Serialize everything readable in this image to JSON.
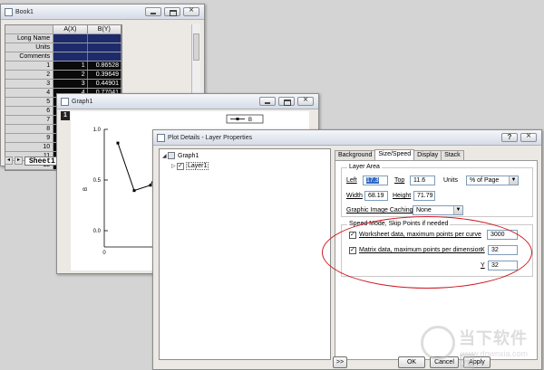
{
  "book1": {
    "title": "Book1",
    "columns": [
      "A(X)",
      "B(Y)"
    ],
    "meta_rows": [
      "Long Name",
      "Units",
      "Comments"
    ],
    "rows": [
      {
        "n": "1",
        "a": "1",
        "b": "0.86528"
      },
      {
        "n": "2",
        "a": "2",
        "b": "0.39649"
      },
      {
        "n": "3",
        "a": "3",
        "b": "0.44901"
      },
      {
        "n": "4",
        "a": "4",
        "b": "0.77041"
      },
      {
        "n": "5",
        "a": "",
        "b": ""
      },
      {
        "n": "6",
        "a": "",
        "b": ""
      },
      {
        "n": "7",
        "a": "",
        "b": ""
      },
      {
        "n": "8",
        "a": "",
        "b": ""
      },
      {
        "n": "9",
        "a": "",
        "b": ""
      },
      {
        "n": "10",
        "a": "",
        "b": ""
      },
      {
        "n": "11",
        "a": "",
        "b": ""
      },
      {
        "n": "12",
        "a": "",
        "b": ""
      }
    ],
    "sheet_tab": "Sheet1"
  },
  "graph1": {
    "title": "Graph1",
    "layer_number": "1",
    "legend": "B",
    "ylabel": "B",
    "yticks": [
      "1.0",
      "0.5",
      "0.0"
    ],
    "xtick": "0",
    "series": [
      0.865,
      0.396,
      0.449,
      0.77
    ]
  },
  "plot_details": {
    "title": "Plot Details - Layer Properties",
    "tree": {
      "root": "Graph1",
      "child": "Layer1"
    },
    "tabs": [
      "Background",
      "Size/Speed",
      "Display",
      "Stack"
    ],
    "active_tab": "Size/Speed",
    "layer_area": {
      "group": "Layer Area",
      "left_label": "Left",
      "left_value": "17.3",
      "top_label": "Top",
      "top_value": "11.6",
      "units_label": "Units",
      "units_value": "% of Page",
      "width_label": "Width",
      "width_value": "68.19",
      "height_label": "Height",
      "height_value": "71.79",
      "caching_label": "Graphic Image Caching",
      "caching_value": "None"
    },
    "speed_mode": {
      "group": "Speed Mode, Skip Points if needed",
      "worksheet_label": "Worksheet data, maximum points per curve",
      "worksheet_value": "3000",
      "matrix_label": "Matrix data, maximum points per dimension",
      "x_label": "X",
      "x_value": "32",
      "y_label": "Y",
      "y_value": "32"
    },
    "buttons": {
      "expand": ">>",
      "ok": "OK",
      "cancel": "Cancel",
      "apply": "Apply"
    }
  },
  "watermark": {
    "cn": "当下软件园",
    "url": "www.downxia.com"
  }
}
